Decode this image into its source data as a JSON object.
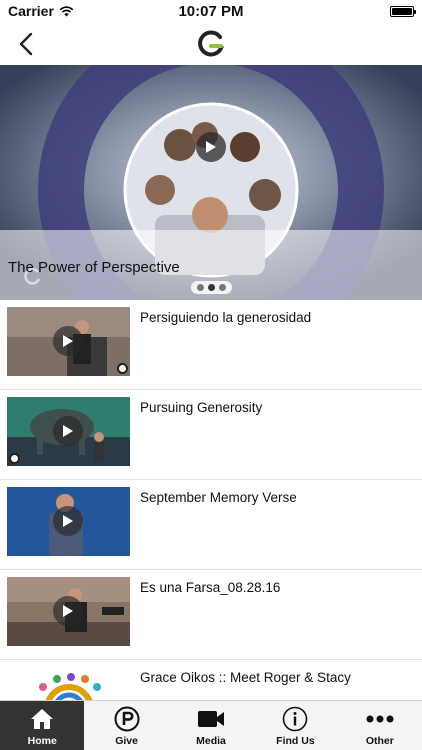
{
  "status_bar": {
    "carrier": "Carrier",
    "time": "10:07 PM"
  },
  "nav": {
    "back_icon": "chevron-left-icon",
    "logo_icon": "grace-logo-icon"
  },
  "hero": {
    "title": "The Power of Perspective",
    "slide_count": 3,
    "active_slide": 2
  },
  "media_list": [
    {
      "title": "Persiguiendo la generosidad"
    },
    {
      "title": "Pursuing Generosity"
    },
    {
      "title": "September Memory Verse"
    },
    {
      "title": "Es una Farsa_08.28.16"
    },
    {
      "title": "Grace Oikos :: Meet Roger & Stacy"
    }
  ],
  "tabs": [
    {
      "label": "Home",
      "icon": "home-icon",
      "active": true
    },
    {
      "label": "Give",
      "icon": "give-icon",
      "active": false
    },
    {
      "label": "Media",
      "icon": "video-camera-icon",
      "active": false
    },
    {
      "label": "Find Us",
      "icon": "info-icon",
      "active": false
    },
    {
      "label": "Other",
      "icon": "more-icon",
      "active": false
    }
  ],
  "colors": {
    "tab_active_bg": "#333333",
    "tab_bar_bg": "#f4f4f4",
    "logo_green": "#8cc63f"
  }
}
